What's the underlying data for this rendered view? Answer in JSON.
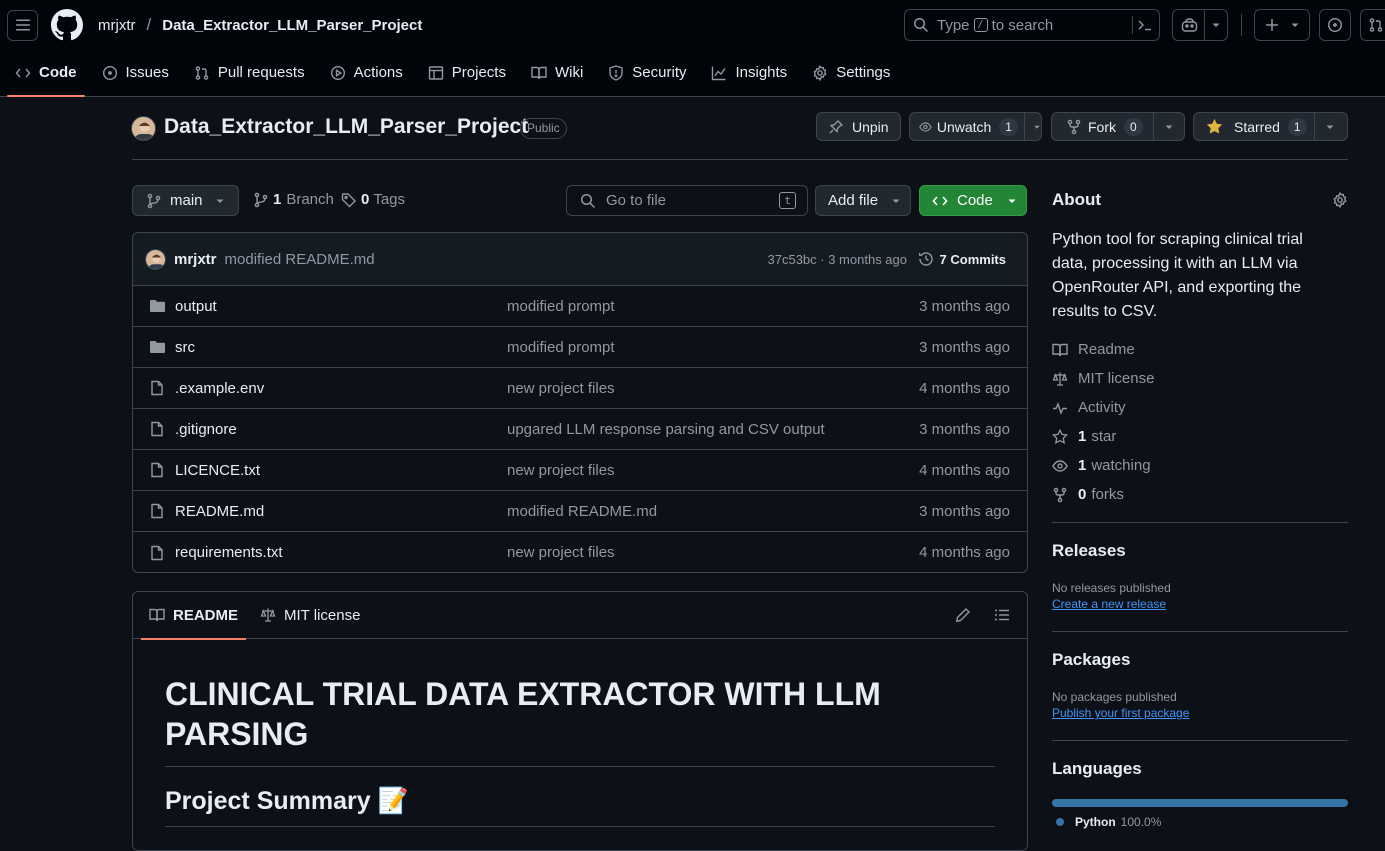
{
  "header": {
    "owner": "mrjxtr",
    "separator": "/",
    "repo": "Data_Extractor_LLM_Parser_Project",
    "search_pre": "Type",
    "search_key": "/",
    "search_post": "to search"
  },
  "tabs": [
    {
      "label": "Code",
      "icon": "code-icon"
    },
    {
      "label": "Issues",
      "icon": "issue-icon"
    },
    {
      "label": "Pull requests",
      "icon": "pull-request-icon"
    },
    {
      "label": "Actions",
      "icon": "play-icon"
    },
    {
      "label": "Projects",
      "icon": "table-icon"
    },
    {
      "label": "Wiki",
      "icon": "book-icon"
    },
    {
      "label": "Security",
      "icon": "shield-icon"
    },
    {
      "label": "Insights",
      "icon": "graph-icon"
    },
    {
      "label": "Settings",
      "icon": "gear-icon"
    }
  ],
  "repo_header": {
    "title": "Data_Extractor_LLM_Parser_Project",
    "visibility": "Public",
    "unpin": "Unpin",
    "unwatch": "Unwatch",
    "watch_count": "1",
    "fork": "Fork",
    "fork_count": "0",
    "starred": "Starred",
    "star_count": "1"
  },
  "toolbar": {
    "branch": "main",
    "branch_count": "1",
    "branch_label": "Branch",
    "tag_count": "0",
    "tag_label": "Tags",
    "goto_placeholder": "Go to file",
    "goto_key": "t",
    "add_file": "Add file",
    "code": "Code"
  },
  "commit": {
    "author": "mrjxtr",
    "message": "modified README.md",
    "meta": "37c53bc · 3 months ago",
    "commits": "7 Commits"
  },
  "files": [
    {
      "name": "output",
      "type": "folder",
      "message": "modified prompt",
      "time": "3 months ago"
    },
    {
      "name": "src",
      "type": "folder",
      "message": "modified prompt",
      "time": "3 months ago"
    },
    {
      "name": ".example.env",
      "type": "file",
      "message": "new project files",
      "time": "4 months ago"
    },
    {
      "name": ".gitignore",
      "type": "file",
      "message": "upgared LLM response parsing and CSV output",
      "time": "3 months ago"
    },
    {
      "name": "LICENCE.txt",
      "type": "file",
      "message": "new project files",
      "time": "4 months ago"
    },
    {
      "name": "README.md",
      "type": "file",
      "message": "modified README.md",
      "time": "3 months ago"
    },
    {
      "name": "requirements.txt",
      "type": "file",
      "message": "new project files",
      "time": "4 months ago"
    }
  ],
  "readme": {
    "tab_readme": "README",
    "tab_license": "MIT license",
    "h1": "CLINICAL TRIAL DATA EXTRACTOR WITH LLM PARSING",
    "h2": "Project Summary 📝"
  },
  "about": {
    "title": "About",
    "description": "Python tool for scraping clinical trial data, processing it with an LLM via OpenRouter API, and exporting the results to CSV.",
    "readme": "Readme",
    "license": "MIT license",
    "activity": "Activity",
    "stars_n": "1",
    "stars": "star",
    "watching_n": "1",
    "watching": "watching",
    "forks_n": "0",
    "forks": "forks"
  },
  "releases": {
    "title": "Releases",
    "none": "No releases published",
    "create": "Create a new release"
  },
  "packages": {
    "title": "Packages",
    "none": "No packages published",
    "publish": "Publish your first package"
  },
  "languages": {
    "title": "Languages",
    "name": "Python",
    "percent": "100.0%",
    "value": 100,
    "color": "#3572A5"
  },
  "colors": {
    "accent": "#f78166",
    "green": "#238636",
    "link": "#4493f8",
    "star": "#e3b341"
  }
}
